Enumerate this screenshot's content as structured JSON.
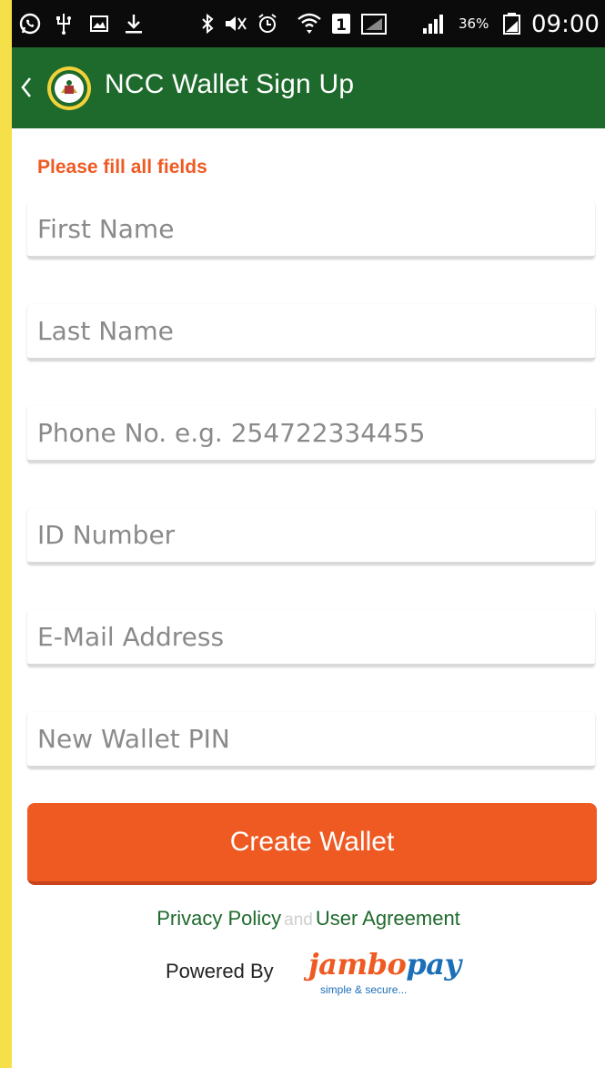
{
  "status_bar": {
    "battery_percent": "36%",
    "time": "09:00",
    "sim_badge": "1",
    "icons": [
      "whatsapp-icon",
      "usb-icon",
      "gallery-icon",
      "download-icon",
      "bluetooth-icon",
      "mute-icon",
      "alarm-icon",
      "wifi-icon",
      "sim-icon",
      "signal-icon",
      "cell-signal-icon",
      "battery-icon"
    ]
  },
  "app_bar": {
    "title": "NCC Wallet Sign Up",
    "back_icon": "chevron-left-icon",
    "logo_icon": "county-logo-icon",
    "color": "#1e6a2c"
  },
  "form": {
    "warning": "Please fill all fields",
    "fields": {
      "first_name": {
        "placeholder": "First Name",
        "value": ""
      },
      "last_name": {
        "placeholder": "Last Name",
        "value": ""
      },
      "phone": {
        "placeholder": "Phone No. e.g. 254722334455",
        "value": ""
      },
      "id_number": {
        "placeholder": "ID Number",
        "value": ""
      },
      "email": {
        "placeholder": "E-Mail Address",
        "value": ""
      },
      "pin": {
        "placeholder": "New Wallet PIN",
        "value": ""
      }
    },
    "submit_label": "Create Wallet",
    "accent_color": "#ef5a22"
  },
  "footer": {
    "privacy_link": "Privacy Policy",
    "and_text": "and",
    "agreement_link": "User Agreement",
    "powered_by": "Powered By",
    "brand_jambo": "jambo",
    "brand_pay": "pay",
    "brand_tagline": "simple & secure..."
  }
}
